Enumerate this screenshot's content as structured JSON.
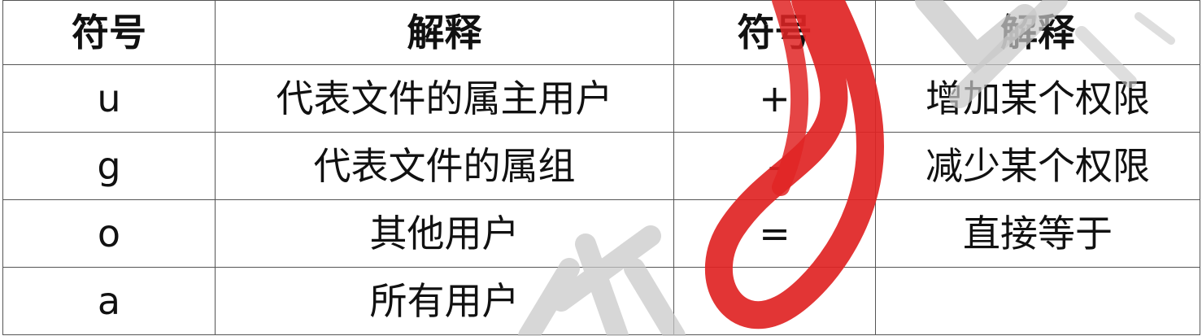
{
  "headers": [
    "符号",
    "解释",
    "符号",
    "解释"
  ],
  "rows": [
    [
      "u",
      "代表文件的属主用户",
      "+",
      "增加某个权限"
    ],
    [
      "g",
      "代表文件的属组",
      "-",
      "减少某个权限"
    ],
    [
      "o",
      "其他用户",
      "=",
      "直接等于"
    ],
    [
      "a",
      "所有用户",
      "",
      ""
    ]
  ],
  "colors": {
    "border": "#555555",
    "text": "#111111",
    "watermark_red": "#e02424",
    "watermark_gray": "#c8c8c8"
  }
}
